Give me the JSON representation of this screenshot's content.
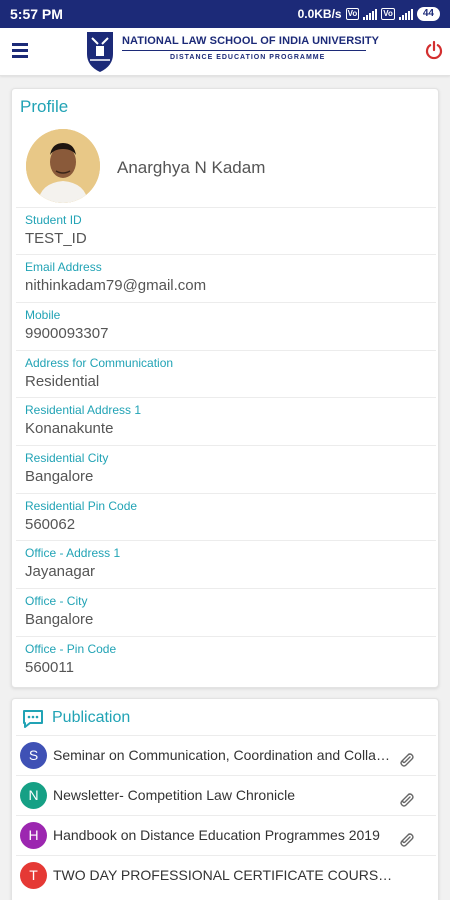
{
  "status_bar": {
    "time": "5:57 PM",
    "network_speed": "0.0KB/s",
    "battery": "44",
    "volte_badge": "Vo"
  },
  "app_bar": {
    "title": "NATIONAL LAW SCHOOL OF INDIA UNIVERSITY",
    "subtitle": "DISTANCE EDUCATION PROGRAMME",
    "menu_icon": "hamburger-menu-icon",
    "power_icon": "power-icon",
    "accent_color": "#1c2a78",
    "power_color": "#d32f2f"
  },
  "profile": {
    "section_title": "Profile",
    "name": "Anarghya N Kadam",
    "fields": [
      {
        "label": "Student ID",
        "value": "TEST_ID"
      },
      {
        "label": "Email Address",
        "value": "nithinkadam79@gmail.com"
      },
      {
        "label": "Mobile",
        "value": "9900093307"
      },
      {
        "label": "Address for Communication",
        "value": "Residential"
      },
      {
        "label": "Residential Address 1",
        "value": "Konanakunte"
      },
      {
        "label": "Residential City",
        "value": "Bangalore"
      },
      {
        "label": "Residential Pin Code",
        "value": "560062"
      },
      {
        "label": "Office - Address 1",
        "value": "Jayanagar"
      },
      {
        "label": "Office - City",
        "value": "Bangalore"
      },
      {
        "label": "Office - Pin Code",
        "value": "560011"
      }
    ],
    "label_color": "#21a3b5"
  },
  "publication": {
    "section_title": "Publication",
    "items": [
      {
        "letter": "S",
        "title": "Seminar on Communication, Coordination and Collaboration",
        "color": "#3f51b5",
        "has_attachment": true
      },
      {
        "letter": "N",
        "title": "Newsletter- Competition Law Chronicle",
        "color": "#16a085",
        "has_attachment": true
      },
      {
        "letter": "H",
        "title": "Handbook on Distance Education Programmes 2019",
        "color": "#9c27b0",
        "has_attachment": true
      },
      {
        "letter": "T",
        "title": "TWO DAY PROFESSIONAL CERTIFICATE COURSE ON COMPETITION LAW",
        "color": "#e53935",
        "has_attachment": false
      }
    ]
  }
}
